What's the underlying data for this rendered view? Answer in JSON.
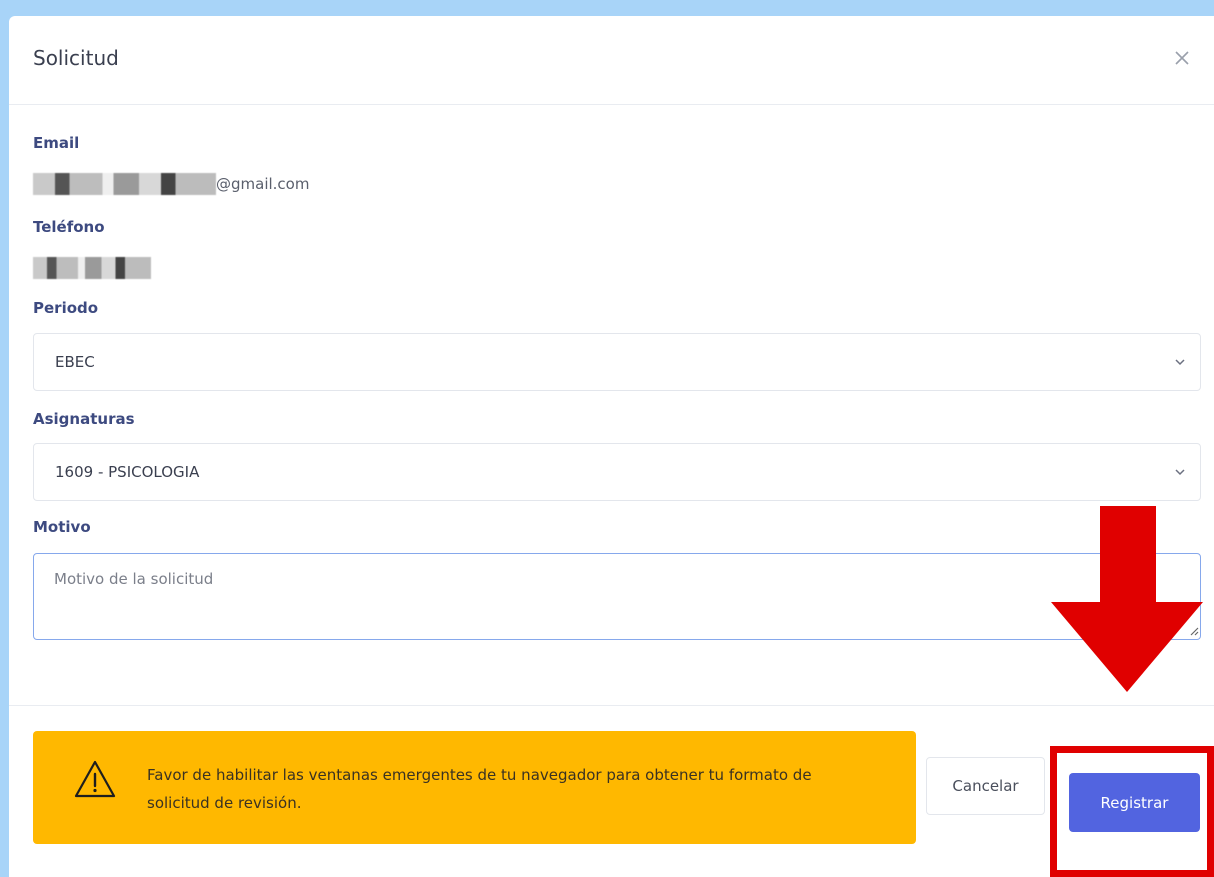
{
  "modal": {
    "title": "Solicitud",
    "close_icon": "close-icon"
  },
  "form": {
    "email_label": "Email",
    "email_domain": "@gmail.com",
    "phone_label": "Teléfono",
    "period_label": "Periodo",
    "period_value": "EBEC",
    "subjects_label": "Asignaturas",
    "subjects_value": "1609 - PSICOLOGIA",
    "reason_label": "Motivo",
    "reason_placeholder": "Motivo de la solicitud",
    "reason_value": ""
  },
  "alert": {
    "icon": "warning-icon",
    "text": "Favor de habilitar las ventanas emergentes de tu navegador para obtener tu formato de solicitud de revisión."
  },
  "buttons": {
    "cancel_label": "Cancelar",
    "submit_label": "Registrar"
  },
  "colors": {
    "page_background": "#a8d4f8",
    "label_color": "#3d4a80",
    "alert_background": "#ffb800",
    "primary_button": "#5264e0",
    "annotation_red": "#e00000"
  }
}
